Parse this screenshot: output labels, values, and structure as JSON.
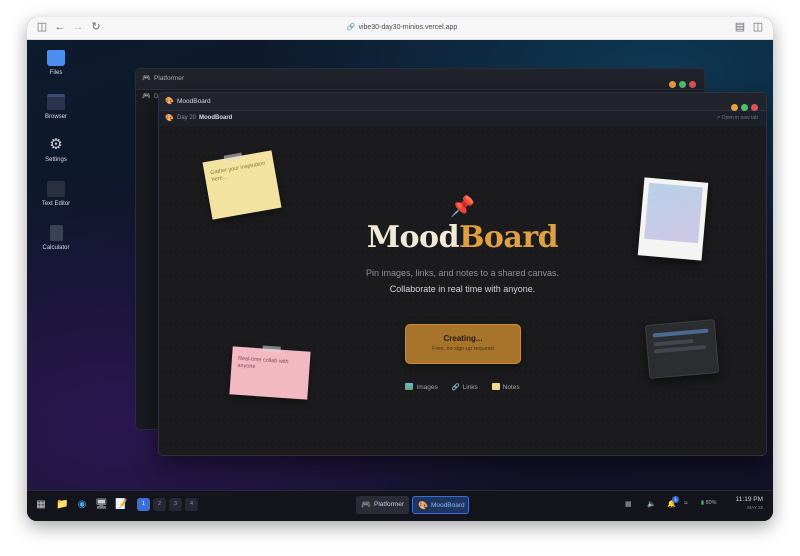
{
  "browser": {
    "url": "vibe30-day30-minios.vercel.app",
    "icons": [
      "sidebar-icon",
      "back-icon",
      "forward-icon",
      "reload-icon",
      "lock-icon",
      "reader-icon",
      "split-view-icon"
    ]
  },
  "desktop_icons": [
    {
      "label": "Files",
      "icon": "folder-icon"
    },
    {
      "label": "Browser",
      "icon": "browser-window-icon"
    },
    {
      "label": "Settings",
      "icon": "gear-icon"
    },
    {
      "label": "Text Editor",
      "icon": "text-editor-icon"
    },
    {
      "label": "Calculator",
      "icon": "calculator-icon"
    }
  ],
  "back_window": {
    "title": "Platformer",
    "icon": "gamepad-icon",
    "partial_label": "D"
  },
  "front_window": {
    "title": "MoodBoard",
    "icon": "palette-icon",
    "breadcrumb_day": "Day 20",
    "breadcrumb_app": "MoodBoard",
    "open_new_tab": "Open in new tab"
  },
  "window_dots": {
    "yellow": "#e8a33d",
    "green": "#4cc36a",
    "red": "#e0525a"
  },
  "hero": {
    "pin_icon": "pushpin-icon",
    "title_part1": "Mood",
    "title_part2": "Board",
    "subtitle1": "Pin images, links, and notes to a shared canvas.",
    "subtitle2": "Collaborate in real time with anyone.",
    "cta_label": "Creating...",
    "cta_sub": "Free, no sign-up required"
  },
  "features": [
    {
      "label": "Images",
      "icon": "image-icon"
    },
    {
      "label": "Links",
      "icon": "link-icon"
    },
    {
      "label": "Notes",
      "icon": "notepad-icon"
    }
  ],
  "notes": {
    "yellow": "Gather your inspiration here...",
    "pink": "Real-time collab with anyone"
  },
  "taskbar": {
    "start_icon": "grid-start-icon",
    "app_icons": [
      "folder-icon",
      "globe-icon",
      "monitor-icon",
      "notepad-icon"
    ],
    "workspaces": [
      "1",
      "2",
      "3",
      "4"
    ],
    "active_workspace": "1",
    "tasks": [
      {
        "label": "Platformer",
        "icon": "gamepad-icon",
        "active": false
      },
      {
        "label": "MoodBoard",
        "icon": "palette-icon",
        "active": true
      }
    ],
    "notification_count": "1",
    "battery": "80%",
    "time": "11:19 PM",
    "date": "MAY 28"
  },
  "colors": {
    "accent_gold": "#e0a040",
    "title_cream": "#f1e9d8",
    "note_yellow": "#f3e3a0",
    "note_pink": "#f2b9c3",
    "active_blue": "#3a6fd8"
  }
}
